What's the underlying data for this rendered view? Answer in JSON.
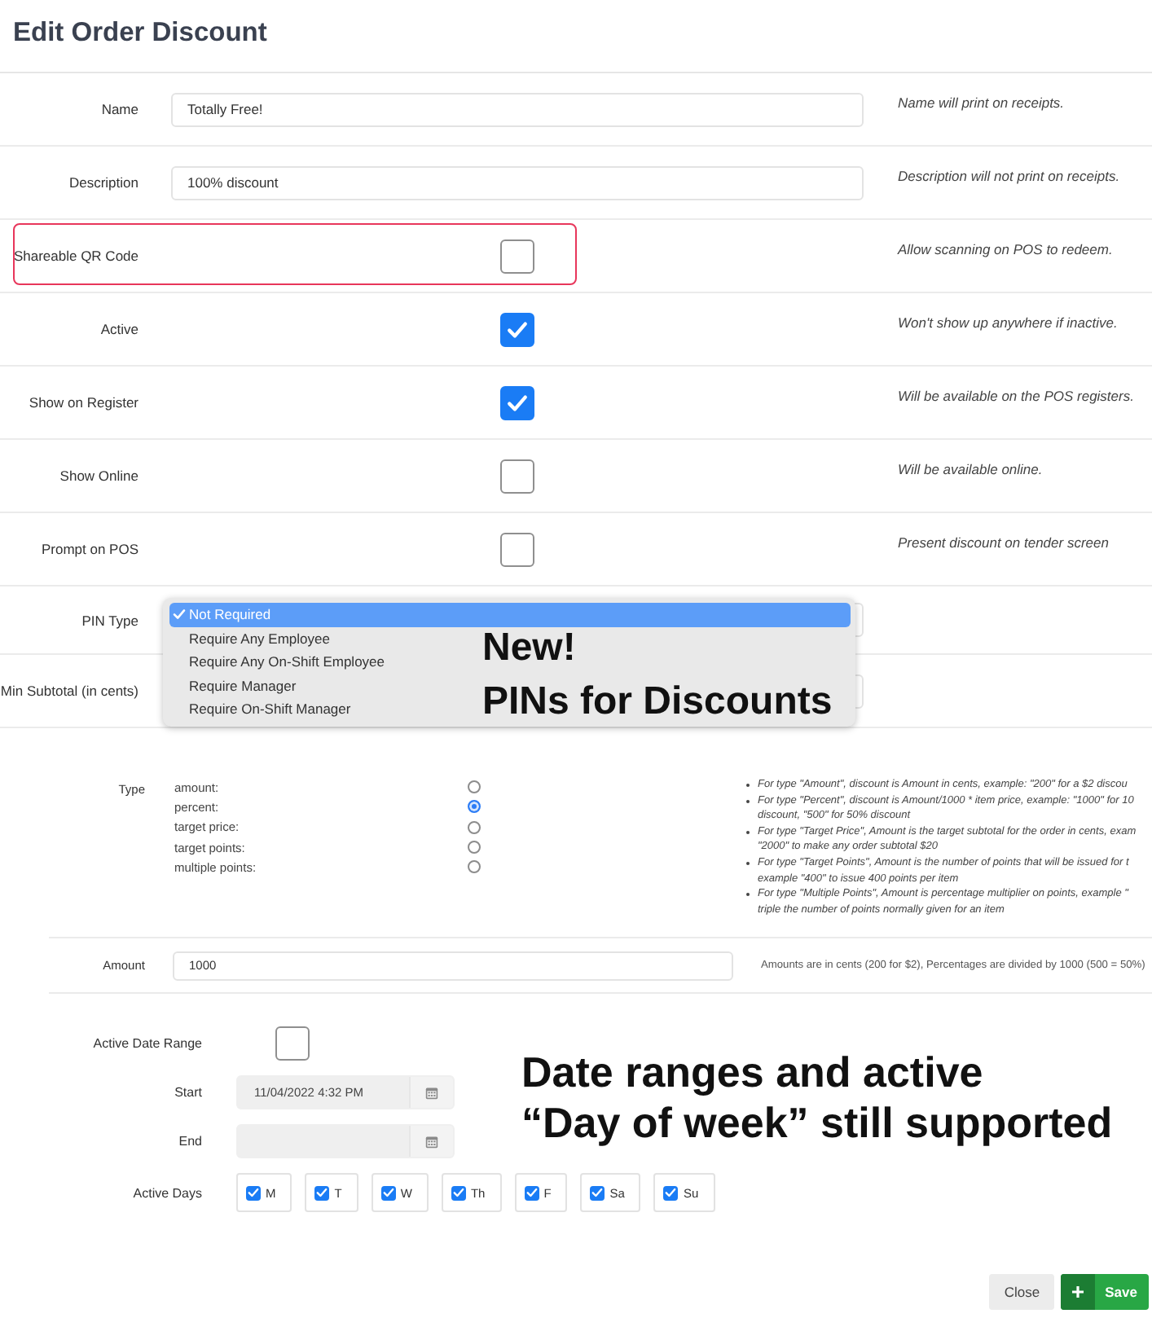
{
  "title": "Edit Order Discount",
  "fields": [
    {
      "kind": "text",
      "label": "Name",
      "value": "Totally Free!",
      "help": "Name will print on receipts.",
      "highlighted": false
    },
    {
      "kind": "text",
      "label": "Description",
      "value": "100% discount",
      "help": "Description will not print on receipts.",
      "highlighted": false
    },
    {
      "kind": "checkbox",
      "label": "Shareable QR Code",
      "checked": false,
      "help": "Allow scanning on POS to redeem.",
      "highlighted": true
    },
    {
      "kind": "checkbox",
      "label": "Active",
      "checked": true,
      "help": "Won't show up anywhere if inactive.",
      "highlighted": false
    },
    {
      "kind": "checkbox",
      "label": "Show on Register",
      "checked": true,
      "help": "Will be available on the POS registers.",
      "highlighted": false
    },
    {
      "kind": "checkbox",
      "label": "Show Online",
      "checked": false,
      "help": "Will be available online.",
      "highlighted": false
    },
    {
      "kind": "checkbox",
      "label": "Prompt on POS",
      "checked": false,
      "help": "Present discount on tender screen",
      "highlighted": false
    },
    {
      "kind": "select",
      "label": "PIN Type",
      "expanded": true,
      "highlighted": false,
      "options": [
        {
          "label": "Not Required",
          "selected": true
        },
        {
          "label": "Require Any Employee",
          "selected": false
        },
        {
          "label": "Require Any On-Shift Employee",
          "selected": false
        },
        {
          "label": "Require Manager",
          "selected": false
        },
        {
          "label": "Require On-Shift Manager",
          "selected": false
        }
      ],
      "callout": [
        "New!",
        "PINs for Discounts"
      ]
    },
    {
      "kind": "text",
      "label": "Min Subtotal (in cents)",
      "highlighted": false
    }
  ],
  "type_section": {
    "label": "Type",
    "options": [
      {
        "label": "amount:",
        "selected": false
      },
      {
        "label": "percent:",
        "selected": true
      },
      {
        "label": "target price:",
        "selected": false
      },
      {
        "label": "target points:",
        "selected": false
      },
      {
        "label": "multiple points:",
        "selected": false
      }
    ],
    "notes": [
      {
        "lines": [
          "For type \"Amount\", discount is Amount in cents, example: \"200\" for a $2 discou"
        ]
      },
      {
        "lines": [
          "For type \"Percent\", discount is Amount/1000 * item price, example: \"1000\" for 10",
          "discount, \"500\" for 50% discount"
        ]
      },
      {
        "lines": [
          "For type \"Target Price\", Amount is the target subtotal for the order in cents, exam",
          "\"2000\" to make any order subtotal $20"
        ]
      },
      {
        "lines": [
          "For type \"Target Points\", Amount is the number of points that will be issued for t",
          "example \"400\" to issue 400 points per item"
        ]
      },
      {
        "lines": [
          "For type \"Multiple Points\", Amount is percentage multiplier on points, example \"",
          "triple the number of points normally given for an item"
        ]
      }
    ]
  },
  "amount": {
    "label": "Amount",
    "value": "1000",
    "help": "Amounts are in cents (200 for $2), Percentages are divided by 1000 (500 = 50%)"
  },
  "date_range": {
    "label": "Active Date Range",
    "checked": false,
    "start": {
      "label": "Start",
      "value": "11/04/2022 4:32 PM"
    },
    "end": {
      "label": "End"
    },
    "callout": [
      "Date ranges and active",
      "“Day of week” still supported"
    ]
  },
  "active_days": {
    "label": "Active Days",
    "days": [
      {
        "label": "M",
        "checked": true
      },
      {
        "label": "T",
        "checked": true
      },
      {
        "label": "W",
        "checked": true
      },
      {
        "label": "Th",
        "checked": true
      },
      {
        "label": "F",
        "checked": true
      },
      {
        "label": "Sa",
        "checked": true
      },
      {
        "label": "Su",
        "checked": true
      }
    ]
  },
  "buttons": [
    {
      "kind": "secondary",
      "label": "Close"
    },
    {
      "kind": "primary",
      "label": "Save"
    }
  ]
}
